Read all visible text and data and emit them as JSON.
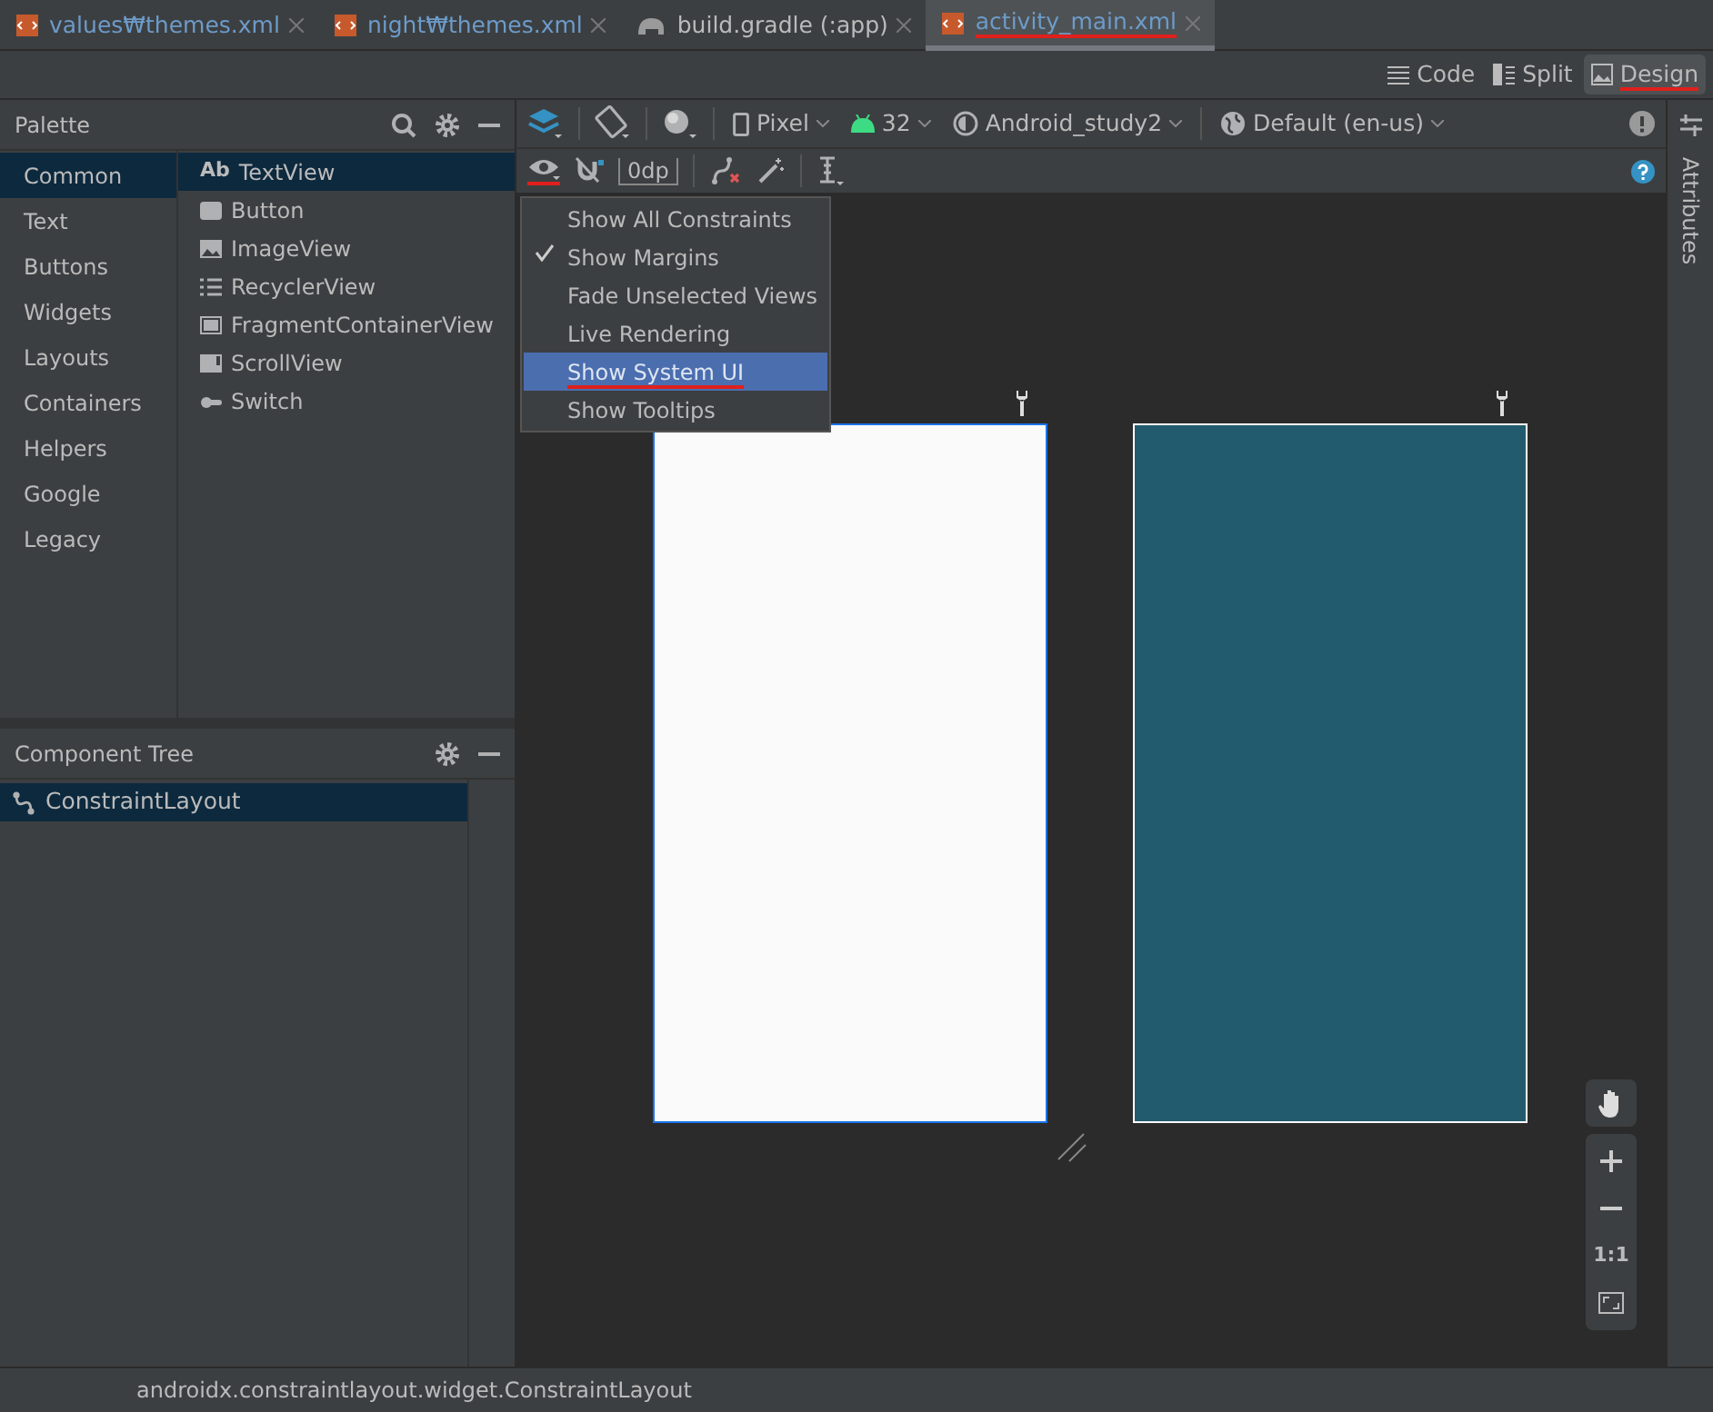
{
  "tabs": [
    {
      "label": "values₩themes.xml",
      "kind": "xml",
      "selected": false,
      "underlined": false
    },
    {
      "label": "night₩themes.xml",
      "kind": "xml",
      "selected": false,
      "underlined": false
    },
    {
      "label": "build.gradle (:app)",
      "kind": "gradle",
      "selected": false,
      "underlined": false
    },
    {
      "label": "activity_main.xml",
      "kind": "xml",
      "selected": true,
      "underlined": true
    }
  ],
  "view_modes": [
    {
      "label": "Code",
      "kind": "code",
      "selected": false,
      "underlined": false
    },
    {
      "label": "Split",
      "kind": "split",
      "selected": false,
      "underlined": false
    },
    {
      "label": "Design",
      "kind": "design",
      "selected": true,
      "underlined": true
    }
  ],
  "palette": {
    "title": "Palette",
    "categories": [
      {
        "label": "Common",
        "selected": true
      },
      {
        "label": "Text",
        "selected": false
      },
      {
        "label": "Buttons",
        "selected": false
      },
      {
        "label": "Widgets",
        "selected": false
      },
      {
        "label": "Layouts",
        "selected": false
      },
      {
        "label": "Containers",
        "selected": false
      },
      {
        "label": "Helpers",
        "selected": false
      },
      {
        "label": "Google",
        "selected": false
      },
      {
        "label": "Legacy",
        "selected": false
      }
    ],
    "items": [
      {
        "label": "TextView",
        "kind": "text",
        "prefix": "Ab",
        "selected": true
      },
      {
        "label": "Button",
        "kind": "button",
        "selected": false
      },
      {
        "label": "ImageView",
        "kind": "image",
        "selected": false
      },
      {
        "label": "RecyclerView",
        "kind": "list",
        "selected": false
      },
      {
        "label": "FragmentContainerView",
        "kind": "fragment",
        "selected": false
      },
      {
        "label": "ScrollView",
        "kind": "scroll",
        "selected": false
      },
      {
        "label": "Switch",
        "kind": "switch",
        "selected": false
      }
    ]
  },
  "toolbar": {
    "device": "Pixel",
    "api": "32",
    "theme": "Android_study2",
    "locale": "Default (en-us)",
    "margin": "0dp",
    "view_options_underlined": true
  },
  "view_options_menu": [
    {
      "label": "Show All Constraints",
      "checked": false,
      "selected": false,
      "underlined": false
    },
    {
      "label": "Show Margins",
      "checked": true,
      "selected": false,
      "underlined": false
    },
    {
      "label": "Fade Unselected Views",
      "checked": false,
      "selected": false,
      "underlined": false
    },
    {
      "label": "Live Rendering",
      "checked": false,
      "selected": false,
      "underlined": false
    },
    {
      "label": "Show System UI",
      "checked": false,
      "selected": true,
      "underlined": true
    },
    {
      "label": "Show Tooltips",
      "checked": false,
      "selected": false,
      "underlined": false
    }
  ],
  "component_tree": {
    "title": "Component Tree",
    "items": [
      {
        "label": "ConstraintLayout",
        "selected": true
      }
    ]
  },
  "previews": [
    {
      "kind": "design",
      "selected": true
    },
    {
      "kind": "blueprint",
      "selected": false
    }
  ],
  "zoom": {
    "actual_size": "1:1"
  },
  "attributes_label": "Attributes",
  "status_bar": "androidx.constraintlayout.widget.ConstraintLayout"
}
